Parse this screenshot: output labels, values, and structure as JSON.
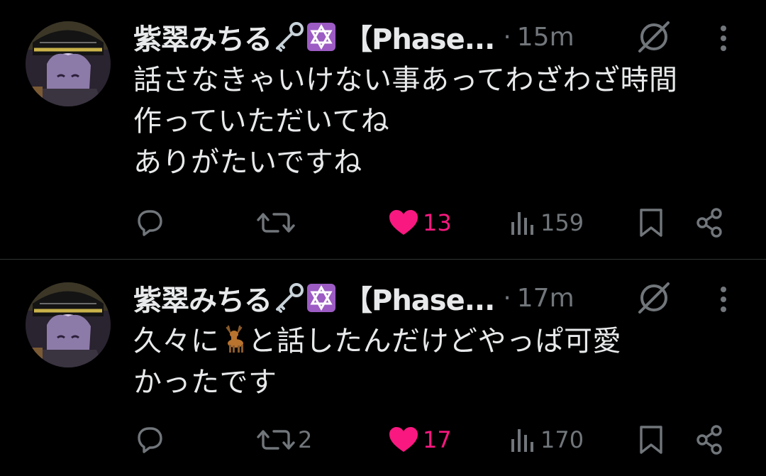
{
  "theme": {
    "background": "#000000",
    "text": "#e7e9ea",
    "secondary": "#71767b",
    "like_color": "#f91880",
    "divider": "#2f3336"
  },
  "tweets": [
    {
      "display_name": "紫翠みちる",
      "name_emojis": [
        "old-key-emoji",
        "star-of-david-emoji"
      ],
      "handle": "【Phase...",
      "dot": "·",
      "time": "15m",
      "text": "話さなきゃいけない事あってわざわざ時間\n作っていただいてね\nありがたいですね",
      "reply_count": "",
      "retweet_count": "",
      "like_count": "13",
      "liked": true,
      "view_count": "159"
    },
    {
      "display_name": "紫翠みちる",
      "name_emojis": [
        "old-key-emoji",
        "star-of-david-emoji"
      ],
      "handle": "【Phase...",
      "dot": "·",
      "time": "17m",
      "text_before_emoji": "久々に",
      "inline_emoji": "deer-emoji",
      "text_after_emoji": "と話したんだけどやっぱ可愛\nかったです",
      "reply_count": "",
      "retweet_count": "2",
      "like_count": "17",
      "liked": true,
      "view_count": "170"
    }
  ]
}
